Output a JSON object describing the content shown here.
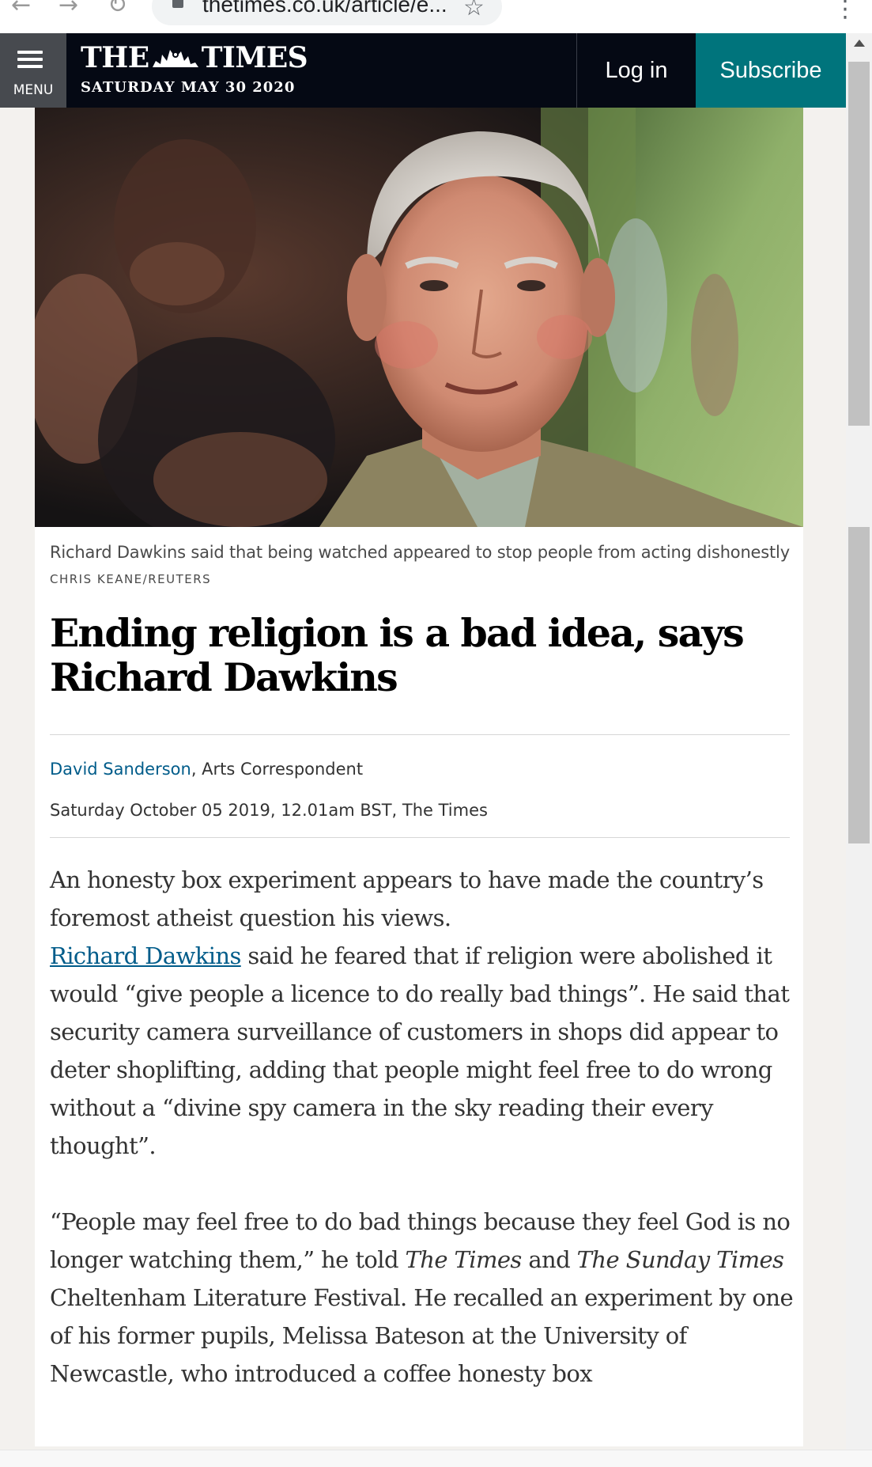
{
  "browser": {
    "url": "thetimes.co.uk/article/e...",
    "back_icon": "arrow-left-icon",
    "forward_icon": "arrow-right-icon",
    "reload_icon": "reload-icon",
    "lock_icon": "lock-icon",
    "bookmark_icon": "star-icon",
    "menu_icon": "kebab-menu-icon"
  },
  "header": {
    "menu_label": "MENU",
    "masthead_left": "THE",
    "masthead_right": "TIMES",
    "date": "SATURDAY MAY 30 2020",
    "login_label": "Log in",
    "subscribe_label": "Subscribe",
    "colors": {
      "header_bg": "#050914",
      "menu_bg": "#474a4f",
      "subscribe_bg": "#00747c"
    }
  },
  "article": {
    "image_caption": "Richard Dawkins said that being watched appeared to stop people from acting dishonestly",
    "image_credit": "CHRIS KEANE/REUTERS",
    "headline": "Ending religion is a bad idea, says Richard Dawkins",
    "author": "David Sanderson",
    "author_role": ", Arts Correspondent",
    "published": "Saturday October 05 2019, 12.01am BST, The Times",
    "paragraphs": [
      {
        "text": "An honesty box experiment appears to have made the country’s foremost atheist question his views."
      },
      {
        "link": "Richard Dawkins",
        "text": " said he feared that if religion were abolished it would “give people a licence to do really bad things”. He said that security camera surveillance of customers in shops did appear to deter shoplifting, adding that people might feel free to do wrong without a “divine spy camera in the sky reading their every thought”."
      },
      {
        "text_a": "“People may feel free to do bad things because they feel God is no longer watching them,” he told ",
        "italic_a": "The Times",
        "text_b": " and ",
        "italic_b": "The Sunday Times",
        "text_c": " Cheltenham Literature Festival. He recalled an experiment by one of his former pupils, Melissa Bateson at the University of Newcastle, who introduced a coffee honesty box"
      }
    ],
    "link_color": "#005c8a"
  }
}
